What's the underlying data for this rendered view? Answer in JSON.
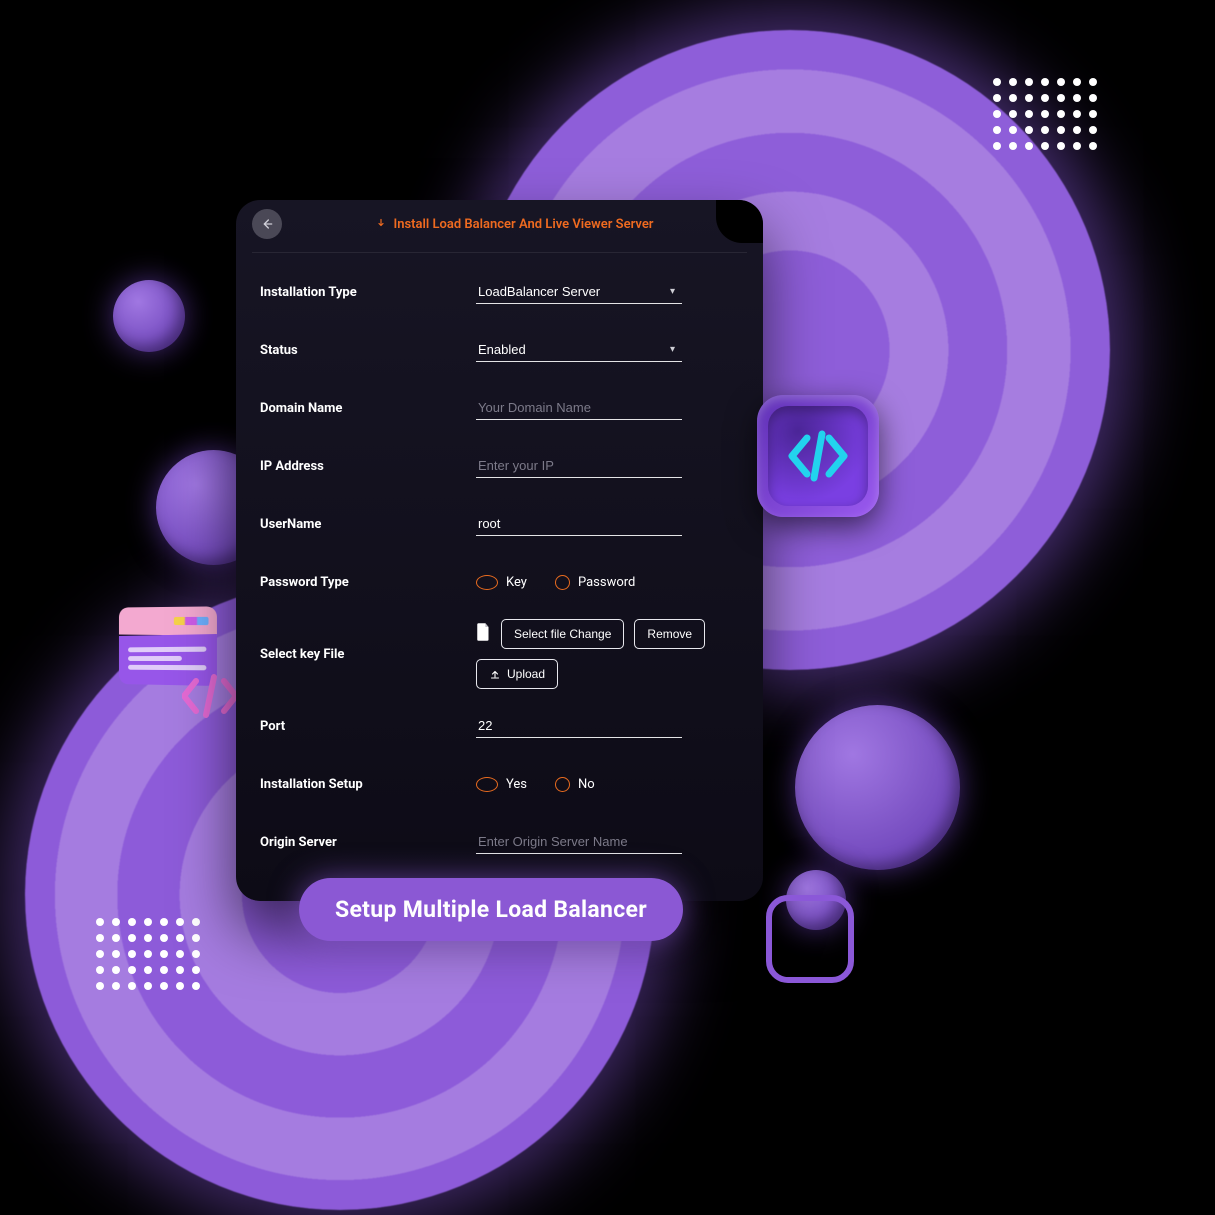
{
  "header": {
    "title": "Install Load Balancer And Live Viewer Server"
  },
  "form": {
    "installation_type": {
      "label": "Installation Type",
      "selected": "LoadBalancer Server",
      "options": [
        "LoadBalancer Server"
      ]
    },
    "status": {
      "label": "Status",
      "selected": "Enabled",
      "options": [
        "Enabled"
      ]
    },
    "domain_name": {
      "label": "Domain Name",
      "value": "",
      "placeholder": "Your Domain Name"
    },
    "ip_address": {
      "label": "IP Address",
      "value": "",
      "placeholder": "Enter your IP"
    },
    "username": {
      "label": "UserName",
      "value": "root",
      "placeholder": ""
    },
    "password_type": {
      "label": "Password Type",
      "selected": "Key",
      "options": [
        {
          "value": "Key",
          "label": "Key"
        },
        {
          "value": "Password",
          "label": "Password"
        }
      ]
    },
    "key_file": {
      "label": "Select key File",
      "buttons": {
        "select_change": "Select file Change",
        "remove": "Remove",
        "upload": "Upload"
      }
    },
    "port": {
      "label": "Port",
      "value": "22",
      "placeholder": ""
    },
    "installation_setup": {
      "label": "Installation Setup",
      "selected": "Yes",
      "options": [
        {
          "value": "Yes",
          "label": "Yes"
        },
        {
          "value": "No",
          "label": "No"
        }
      ]
    },
    "origin_server": {
      "label": "Origin Server",
      "value": "",
      "placeholder": "Enter Origin Server Name"
    }
  },
  "caption": "Setup Multiple Load Balancer",
  "theme": {
    "accent": "#ee6a20",
    "purple": "#8b58d4",
    "panel_bg": "#131122",
    "cyan": "#22d3ee"
  }
}
